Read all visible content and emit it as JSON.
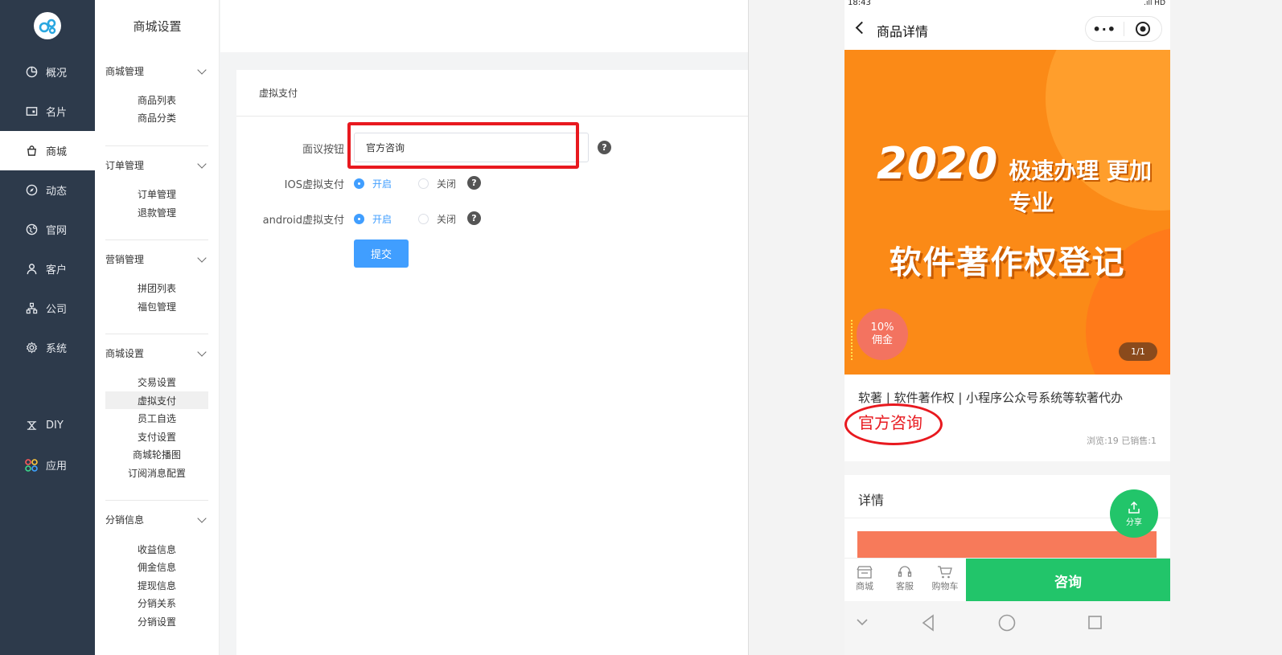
{
  "nav": {
    "items": [
      {
        "label": "概况",
        "icon": "dashboard-icon"
      },
      {
        "label": "名片",
        "icon": "card-icon"
      },
      {
        "label": "商城",
        "icon": "shop-bag-icon"
      },
      {
        "label": "动态",
        "icon": "compass-icon"
      },
      {
        "label": "官网",
        "icon": "globe-icon"
      },
      {
        "label": "客户",
        "icon": "user-icon"
      },
      {
        "label": "公司",
        "icon": "org-icon"
      },
      {
        "label": "系统",
        "icon": "gear-icon"
      },
      {
        "label": "DIY",
        "icon": "diy-icon"
      },
      {
        "label": "应用",
        "icon": "apps-icon"
      }
    ],
    "active": "商城"
  },
  "submenu": {
    "title": "商城设置",
    "groups": [
      {
        "title": "商城管理",
        "items": [
          "商品列表",
          "商品分类"
        ]
      },
      {
        "title": "订单管理",
        "items": [
          "订单管理",
          "退款管理"
        ]
      },
      {
        "title": "营销管理",
        "items": [
          "拼团列表",
          "福包管理"
        ]
      },
      {
        "title": "商城设置",
        "items": [
          "交易设置",
          "虚拟支付",
          "员工自选",
          "支付设置",
          "商城轮播图",
          "订阅消息配置"
        ]
      },
      {
        "title": "分销信息",
        "items": [
          "收益信息",
          "佣金信息",
          "提现信息",
          "分销关系",
          "分销设置"
        ]
      }
    ],
    "active_item": "虚拟支付"
  },
  "form": {
    "card_title": "虚拟支付",
    "face_button_label": "面议按钮",
    "face_button_value": "官方咨询",
    "ios_label": "IOS虚拟支付",
    "android_label": "android虚拟支付",
    "option_on": "开启",
    "option_off": "关闭",
    "help_glyph": "?",
    "submit_label": "提交"
  },
  "phone": {
    "status_time": "18:43",
    "status_right": ".ıll HD",
    "page_title": "商品详情",
    "capsule_more": "•·•",
    "banner_year": "2020",
    "banner_slogan": "极速办理 更加专业",
    "banner_title": "软件著作权登记",
    "commission_pct": "10%",
    "commission_label": "佣金",
    "image_counter": "1/1",
    "product_name": "软著 | 软件著作权 | 小程序公众号系统等软著代办",
    "product_price": "官方咨询",
    "stats": "浏览:19 已销售:1",
    "detail_title": "详情",
    "share_label": "分享",
    "tabs": [
      "商城",
      "客服",
      "购物车"
    ],
    "consult_label": "咨询"
  },
  "colors": {
    "nav_bg": "#2d3a4b",
    "primary": "#409eff",
    "highlight_red": "#e8191f",
    "banner_orange": "#fb8a17",
    "green": "#22c56a"
  }
}
